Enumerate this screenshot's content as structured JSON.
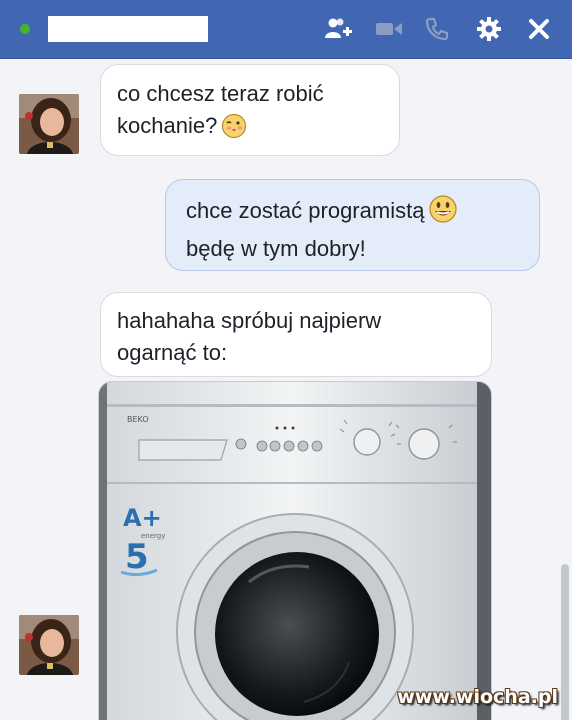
{
  "header": {
    "contact_name": "",
    "status": "online",
    "icons": [
      "add-friend-icon",
      "video-call-icon",
      "phone-icon",
      "gear-icon",
      "close-icon"
    ],
    "accent_color": "#4267b2"
  },
  "messages": [
    {
      "from": "contact",
      "lines": [
        "co chcesz teraz robić",
        "kochanie?"
      ],
      "emoji": "kiss-emoji-icon"
    },
    {
      "from": "me",
      "lines": [
        "chce zostać programistą",
        "będę w tym dobry!"
      ],
      "emoji": "smile-emoji-icon"
    },
    {
      "from": "contact",
      "lines": [
        "hahahaha spróbuj najpierw",
        "ogarnąć to:"
      ]
    }
  ],
  "photo": {
    "brand": "BEKO",
    "energy_label": "A+",
    "energy_sub": "energy",
    "capacity": "5"
  },
  "watermark": "www.wiocha.pl"
}
